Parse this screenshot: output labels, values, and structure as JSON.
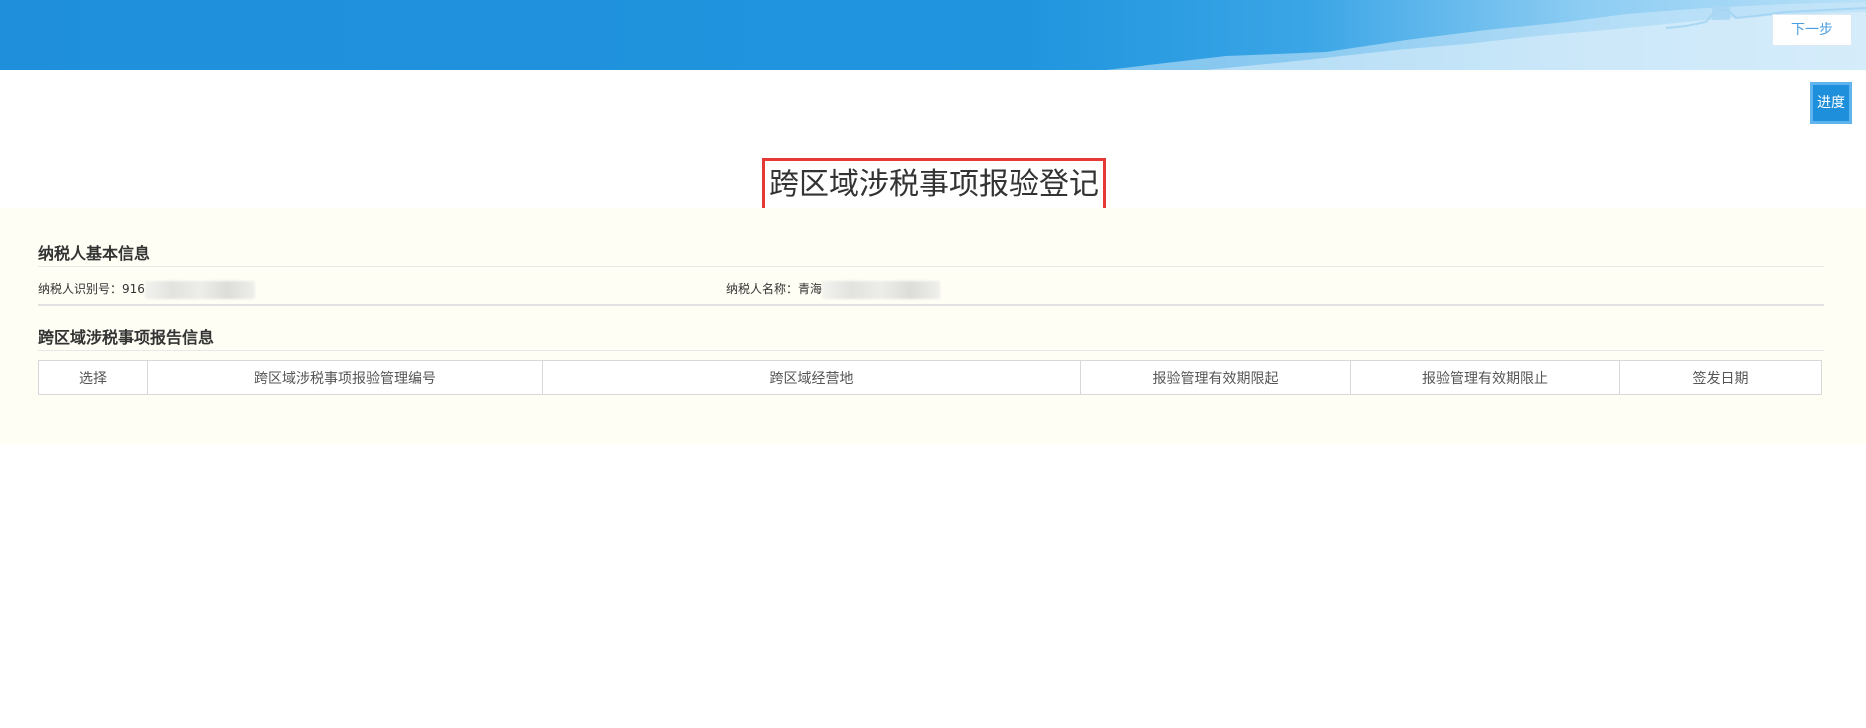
{
  "header": {
    "next_label": "下一步"
  },
  "progress_label": "进度",
  "page_title": "跨区域涉税事项报验登记",
  "taxpayer_section": {
    "title": "纳税人基本信息",
    "id_label": "纳税人识别号：",
    "id_value_visible": "916",
    "name_label": "纳税人名称：",
    "name_value_visible": "青海"
  },
  "report_section": {
    "title": "跨区域涉税事项报告信息",
    "columns": [
      "选择",
      "跨区域涉税事项报验管理编号",
      "跨区域经营地",
      "报验管理有效期限起",
      "报验管理有效期限止",
      "签发日期"
    ]
  },
  "colors": {
    "header_blue": "#1f8fdc",
    "title_border": "#e53935",
    "panel_bg": "#fffef5"
  }
}
